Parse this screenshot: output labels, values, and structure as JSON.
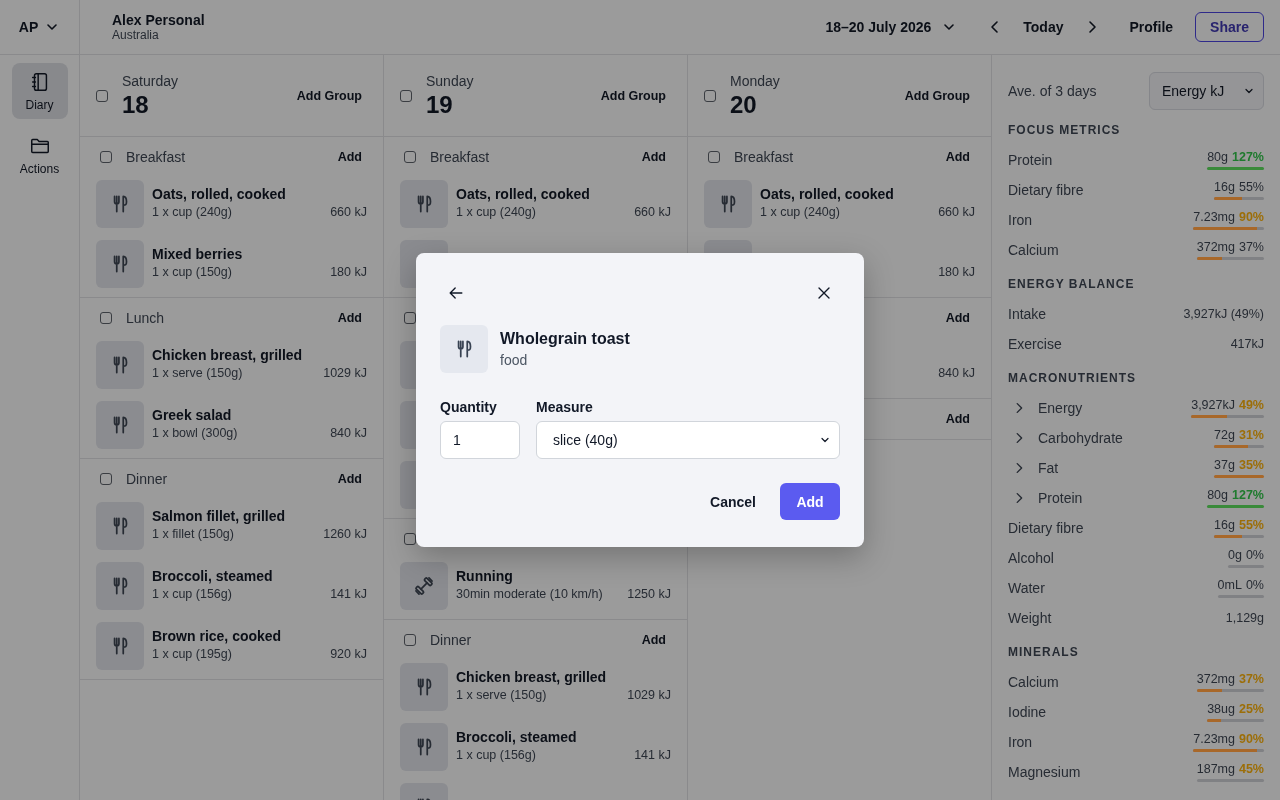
{
  "account": {
    "initials": "AP"
  },
  "nav": [
    {
      "label": "Diary",
      "selected": true
    },
    {
      "label": "Actions",
      "selected": false
    }
  ],
  "header": {
    "name": "Alex Personal",
    "region": "Australia",
    "date_range": "18–20 July 2026",
    "today": "Today",
    "profile": "Profile",
    "share": "Share"
  },
  "days": [
    {
      "weekday": "Saturday",
      "date": "18",
      "checked": false,
      "add_group": "Add Group",
      "groups": [
        {
          "title": "Breakfast",
          "checked": false,
          "add": "Add",
          "items": [
            {
              "kind": "food",
              "name": "Oats, rolled, cooked",
              "serving": "1 x cup (240g)",
              "energy": "660 kJ"
            },
            {
              "kind": "food",
              "name": "Mixed berries",
              "serving": "1 x cup (150g)",
              "energy": "180 kJ"
            }
          ]
        },
        {
          "title": "Lunch",
          "checked": false,
          "add": "Add",
          "items": [
            {
              "kind": "food",
              "name": "Chicken breast, grilled",
              "serving": "1 x serve (150g)",
              "energy": "1029 kJ"
            },
            {
              "kind": "food",
              "name": "Greek salad",
              "serving": "1 x bowl (300g)",
              "energy": "840 kJ"
            }
          ]
        },
        {
          "title": "Dinner",
          "checked": false,
          "add": "Add",
          "items": [
            {
              "kind": "food",
              "name": "Salmon fillet, grilled",
              "serving": "1 x fillet (150g)",
              "energy": "1260 kJ"
            },
            {
              "kind": "food",
              "name": "Broccoli, steamed",
              "serving": "1 x cup (156g)",
              "energy": "141 kJ"
            },
            {
              "kind": "food",
              "name": "Brown rice, cooked",
              "serving": "1 x cup (195g)",
              "energy": "920 kJ"
            }
          ]
        }
      ]
    },
    {
      "weekday": "Sunday",
      "date": "19",
      "checked": false,
      "add_group": "Add Group",
      "groups": [
        {
          "title": "Breakfast",
          "checked": false,
          "add": "Add",
          "items": [
            {
              "kind": "food",
              "name": "Oats, rolled, cooked",
              "serving": "1 x cup (240g)",
              "energy": "660 kJ"
            },
            {
              "kind": "food"
            }
          ]
        },
        {
          "checked": false,
          "items": [
            {
              "kind": "food"
            },
            {
              "kind": "food"
            },
            {
              "kind": "food"
            }
          ]
        },
        {
          "checked": false,
          "items": [
            {
              "kind": "exercise",
              "name": "Running",
              "serving": "30min moderate (10 km/h)",
              "energy": "1250 kJ"
            }
          ]
        },
        {
          "title": "Dinner",
          "checked": false,
          "add": "Add",
          "items": [
            {
              "kind": "food",
              "name": "Chicken breast, grilled",
              "serving": "1 x serve (150g)",
              "energy": "1029 kJ"
            },
            {
              "kind": "food",
              "name": "Broccoli, steamed",
              "serving": "1 x cup (156g)",
              "energy": "141 kJ"
            },
            {
              "kind": "food"
            }
          ]
        }
      ]
    },
    {
      "weekday": "Monday",
      "date": "20",
      "checked": false,
      "add_group": "Add Group",
      "groups": [
        {
          "title": "Breakfast",
          "checked": false,
          "add": "Add",
          "items": [
            {
              "kind": "food",
              "name": "Oats, rolled, cooked",
              "serving": "1 x cup (240g)",
              "energy": "660 kJ"
            },
            {
              "kind": "food",
              "energy": "180 kJ"
            }
          ]
        },
        {
          "add": "Add",
          "items": [
            {
              "kind": "none",
              "energy": "840 kJ"
            }
          ]
        },
        {
          "add": "Add"
        }
      ]
    }
  ],
  "summary": {
    "caption": "Ave. of 3 days",
    "metric": "Energy kJ",
    "sections": [
      {
        "title": "FOCUS METRICS",
        "rows": [
          {
            "label": "Protein",
            "value": "80g",
            "percent": {
              "text": "127%",
              "color": "#1f7a2e"
            },
            "level": 1,
            "color": "#3a8a3a"
          },
          {
            "label": "Dietary fibre",
            "value": "16g",
            "percent": {
              "text": "55%"
            },
            "level": 0.55,
            "color": "#a8682a"
          },
          {
            "label": "Iron",
            "value": "7.23mg",
            "percent": {
              "text": "90%",
              "color": "#9c6e08"
            },
            "level": 0.9,
            "color": "#a8682a"
          },
          {
            "label": "Calcium",
            "value": "372mg",
            "percent": {
              "text": "37%"
            },
            "level": 0.37,
            "color": "#a8682a"
          }
        ]
      },
      {
        "title": "ENERGY BALANCE",
        "rows": [
          {
            "label": "Intake",
            "value": "3,927kJ (49%)"
          },
          {
            "label": "Exercise",
            "value": "417kJ"
          }
        ]
      },
      {
        "title": "MACRONUTRIENTS",
        "rows": [
          {
            "label": "Energy",
            "expanded": false,
            "value": "3,927kJ",
            "percent": {
              "text": "49%",
              "color": "#9c6e08"
            },
            "level": 0.49,
            "color": "#a8682a"
          },
          {
            "label": "Carbohydrate",
            "expanded": false,
            "value": "72g",
            "percent": {
              "text": "31%",
              "color": "#9c6e08"
            },
            "level": 0.67,
            "color": "#a8682a"
          },
          {
            "label": "Fat",
            "expanded": false,
            "value": "37g",
            "percent": {
              "text": "35%",
              "color": "#9c6e08"
            },
            "level": 1,
            "color": "#a8682a"
          },
          {
            "label": "Protein",
            "expanded": false,
            "value": "80g",
            "percent": {
              "text": "127%",
              "color": "#1f7a2e"
            },
            "level": 1,
            "color": "#3a8a3a"
          },
          {
            "label": "Dietary fibre",
            "value": "16g",
            "percent": {
              "text": "55%",
              "color": "#9c6e08"
            },
            "level": 0.55,
            "color": "#a8682a"
          },
          {
            "label": "Alcohol",
            "value": "0g",
            "percent": {
              "text": "0%"
            }
          },
          {
            "label": "Water",
            "value": "0mL",
            "percent": {
              "text": "0%"
            }
          },
          {
            "label": "Weight",
            "value": "1,129g"
          }
        ]
      },
      {
        "title": "MINERALS",
        "rows": [
          {
            "label": "Calcium",
            "value": "372mg",
            "percent": {
              "text": "37%",
              "color": "#9c6e08"
            },
            "level": 0.37,
            "color": "#a8682a"
          },
          {
            "label": "Iodine",
            "value": "38ug",
            "percent": {
              "text": "25%",
              "color": "#9c6e08"
            },
            "level": 0.25,
            "color": "#a8682a"
          },
          {
            "label": "Iron",
            "value": "7.23mg",
            "percent": {
              "text": "90%",
              "color": "#9c6e08"
            },
            "level": 0.9,
            "color": "#a8682a"
          },
          {
            "label": "Magnesium",
            "value": "187mg",
            "percent": {
              "text": "45%",
              "color": "#9c6e08"
            }
          }
        ]
      }
    ]
  },
  "dialog": {
    "title": "Wholegrain toast",
    "category": "food",
    "quantity_label": "Quantity",
    "quantity": "1",
    "measure_label": "Measure",
    "measure": "slice (40g)",
    "cancel": "Cancel",
    "confirm": "Add"
  }
}
